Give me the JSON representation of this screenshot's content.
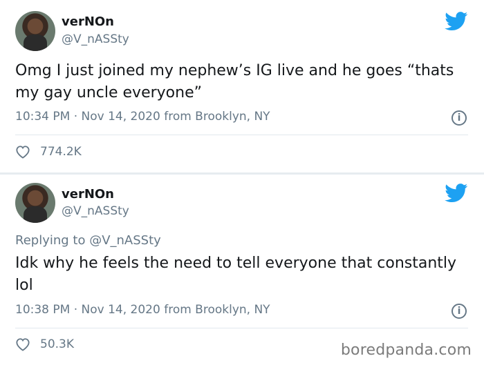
{
  "tweets": [
    {
      "display_name": "verNOn",
      "handle": "@V_nASSty",
      "replying_to": "",
      "text": "Omg I just joined my nephew’s IG live and he goes “thats my gay uncle everyone”",
      "timestamp": "10:34 PM · Nov 14, 2020 from Brooklyn, NY",
      "likes": "774.2K"
    },
    {
      "display_name": "verNOn",
      "handle": "@V_nASSty",
      "replying_to": "Replying to @V_nASSty",
      "text": "Idk why he feels the need to tell everyone that constantly lol",
      "timestamp": "10:38 PM · Nov 14, 2020 from Brooklyn, NY",
      "likes": "50.3K"
    }
  ],
  "icons": {
    "twitter_bird": "twitter-bird-icon",
    "info": "info-icon",
    "like": "heart-icon",
    "info_glyph": "i"
  },
  "colors": {
    "twitter_blue": "#1da1f2",
    "secondary_text": "#657786",
    "divider": "#e6ecf0"
  },
  "watermark": "boredpanda.com"
}
